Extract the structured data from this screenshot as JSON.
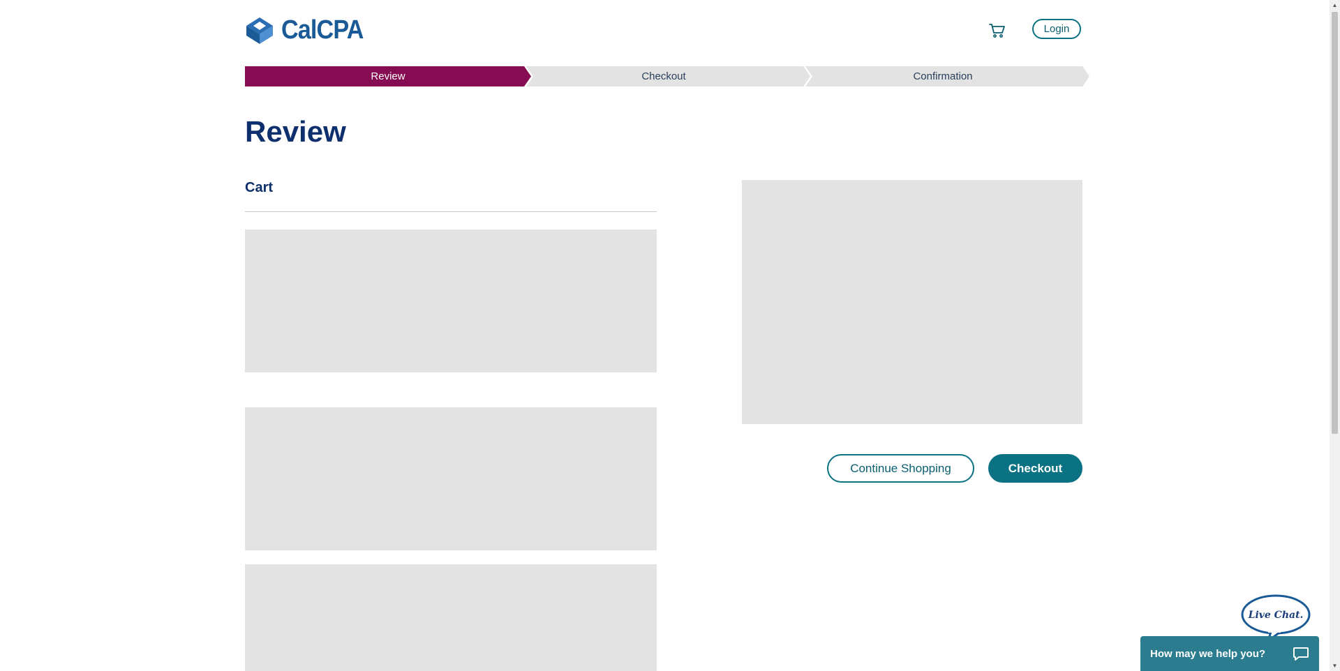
{
  "brand": {
    "name": "CalCPA",
    "primary_color": "#1a5a97",
    "accent_color": "#850b52",
    "teal_color": "#0a7282"
  },
  "header": {
    "cart_icon": "cart-icon",
    "login_label": "Login"
  },
  "stepper": {
    "steps": [
      {
        "label": "Review",
        "active": true
      },
      {
        "label": "Checkout",
        "active": false
      },
      {
        "label": "Confirmation",
        "active": false
      }
    ]
  },
  "main": {
    "title": "Review",
    "cart_heading": "Cart"
  },
  "actions": {
    "continue_label": "Continue Shopping",
    "checkout_label": "Checkout"
  },
  "chat": {
    "bubble_text": "Live Chat.",
    "bar_text": "How may we help you?",
    "icon": "chat-icon"
  }
}
